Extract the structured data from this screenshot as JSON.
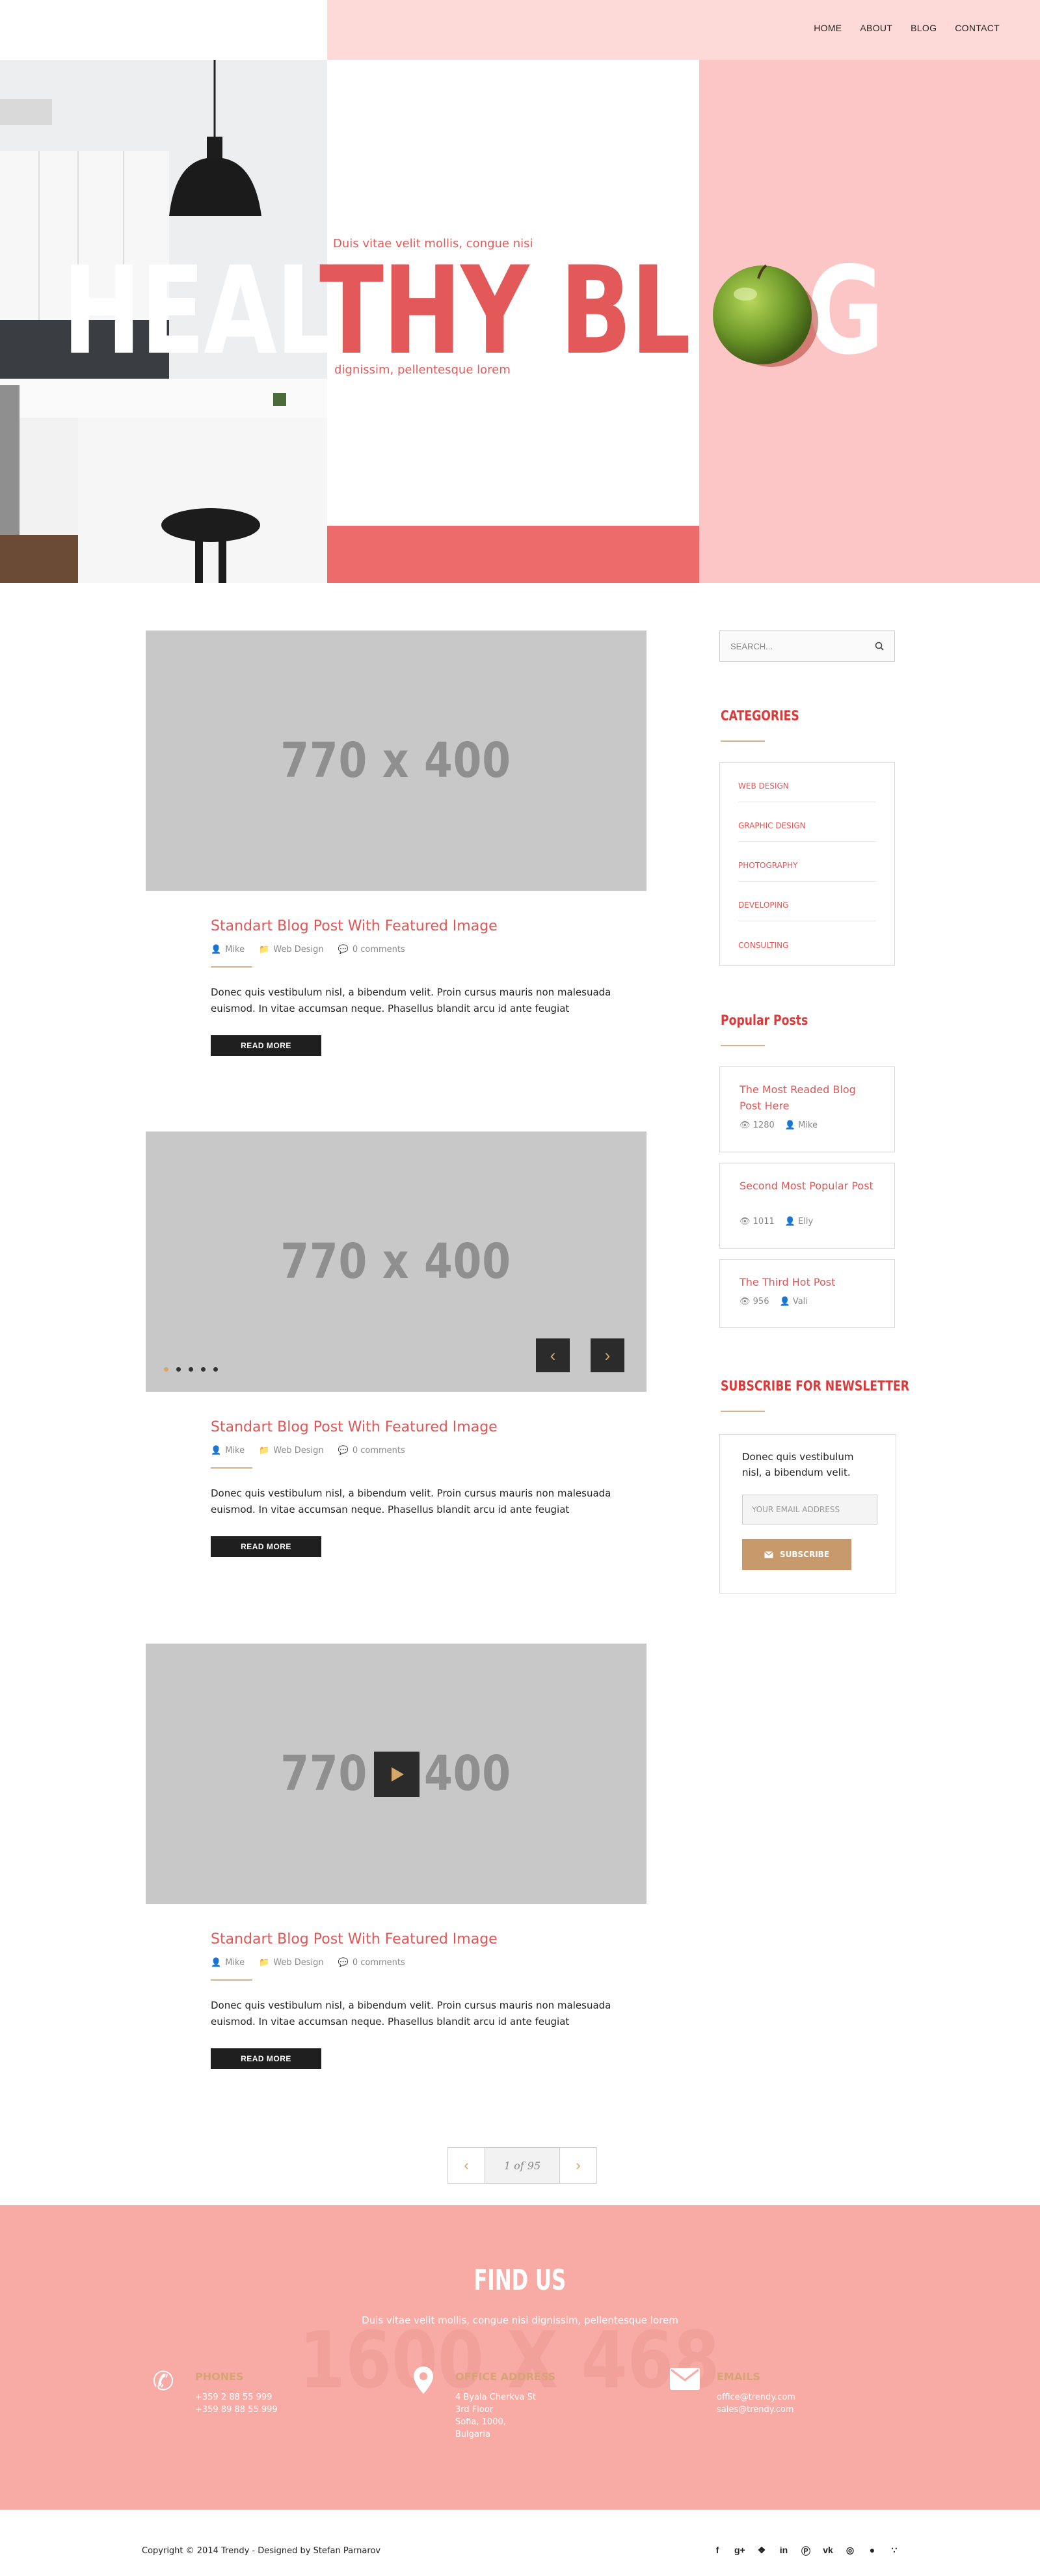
{
  "nav": {
    "items": [
      "HOME",
      "ABOUT",
      "BLOG",
      "CONTACT"
    ]
  },
  "hero": {
    "title_white": "HEAL",
    "title_red": "THY BL",
    "title_tail": "G",
    "subtitle_top": "Duis vitae velit mollis, congue nisi",
    "subtitle_bottom": "dignissim, pellentesque lorem"
  },
  "posts": [
    {
      "placeholder": "770 x 400",
      "title": "Standart Blog Post With Featured Image",
      "author": "Mike",
      "category": "Web Design",
      "comments": "0 comments",
      "excerpt": "Donec quis vestibulum nisl, a bibendum velit. Proin cursus mauris non malesuada euismod. In vitae accumsan neque. Phasellus blandit arcu id ante feugiat",
      "button": "READ MORE"
    },
    {
      "placeholder": "770 x 400",
      "title": "Standart Blog Post With Featured Image",
      "author": "Mike",
      "category": "Web Design",
      "comments": "0 comments",
      "excerpt": "Donec quis vestibulum nisl, a bibendum velit. Proin cursus mauris non malesuada euismod. In vitae accumsan neque. Phasellus blandit arcu id ante feugiat",
      "button": "READ MORE"
    },
    {
      "placeholder": "770 x 400",
      "title": "Standart Blog Post With Featured Image",
      "author": "Mike",
      "category": "Web Design",
      "comments": "0 comments",
      "excerpt": "Donec quis vestibulum nisl, a bibendum velit. Proin cursus mauris non malesuada euismod. In vitae accumsan neque. Phasellus blandit arcu id ante feugiat",
      "button": "READ MORE"
    }
  ],
  "sidebar": {
    "search_placeholder": "SEARCH...",
    "categories_heading": "CATEGORIES",
    "categories": [
      "WEB DESIGN",
      "GRAPHIC DESIGN",
      "PHOTOGRAPHY",
      "DEVELOPING",
      "CONSULTING"
    ],
    "popular_heading": "Popular Posts",
    "popular": [
      {
        "title": "The Most Readed Blog Post Here",
        "views": "1280",
        "author": "Mike"
      },
      {
        "title": "Second Most Popular Post",
        "views": "1011",
        "author": "Elly"
      },
      {
        "title": "The Third Hot Post",
        "views": "956",
        "author": "Vali"
      }
    ],
    "newsletter_heading": "SUBSCRIBE FOR NEWSLETTER",
    "newsletter_text": "Donec quis vestibulum nisl, a bibendum velit.",
    "newsletter_placeholder": "YOUR EMAIL ADDRESS",
    "newsletter_button": "SUBSCRIBE"
  },
  "pagination": {
    "info": "1 of 95"
  },
  "find_us": {
    "title": "FIND US",
    "subtitle": "Duis vitae velit mollis, congue nisi dignissim, pellentesque lorem",
    "watermark": "1600 X 468",
    "phones_heading": "PHONES",
    "phones": [
      "+359 2 88 55 999",
      "+359 89 88 55 999"
    ],
    "office_heading": "OFFICE ADDRESS",
    "office": [
      "4 Byala Cherkva St",
      "3rd Floor",
      "Sofia, 1000,",
      "Bulgaria"
    ],
    "emails_heading": "EMAILS",
    "emails": [
      "office@trendy.com",
      "sales@trendy.com"
    ]
  },
  "footer": {
    "copyright": "Copyright © 2014 Trendy - Designed by Stefan Parnarov"
  },
  "colors": {
    "accent_red": "#e05656",
    "hero_pink": "#fdc6c6",
    "footer_pink": "#f8aaa5",
    "gold": "#d5a56a"
  }
}
